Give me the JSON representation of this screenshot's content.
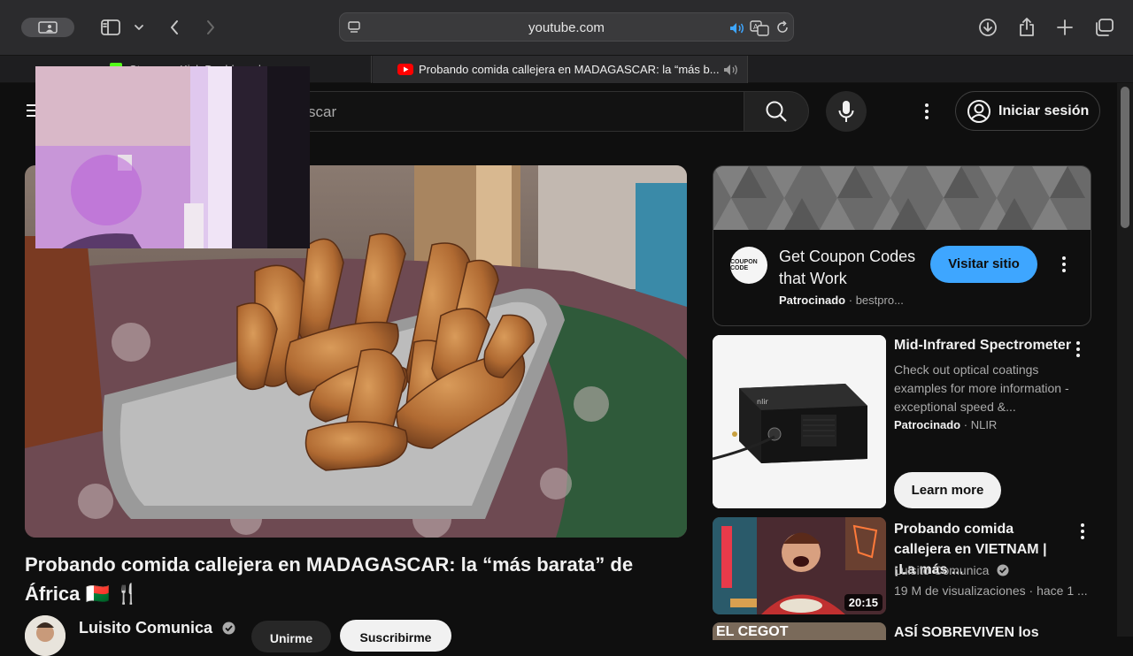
{
  "browser": {
    "address": "youtube.com",
    "tabs": [
      {
        "title": "Streamer Kick Dashboard"
      },
      {
        "title": "Probando comida callejera en MADAGASCAR: la “más b..."
      }
    ]
  },
  "header": {
    "search_placeholder": "scar",
    "signin_label": "Iniciar sesión"
  },
  "video": {
    "title": "Probando comida callejera en MADAGASCAR: la “más barata” de África 🇲🇬 🍴",
    "channel": "Luisito Comunica",
    "join_label": "Unirme",
    "subscribe_label": "Suscribirme"
  },
  "ad": {
    "logo_text": "COUPON CODE",
    "title": "Get Coupon Codes that Work",
    "sponsored": "Patrocinado",
    "domain": "bestpro...",
    "visit_label": "Visitar sitio"
  },
  "promo": {
    "title": "Mid-Infrared Spectrometer",
    "description": "Check out optical coatings examples for more information - exceptional speed &...",
    "sponsored": "Patrocinado",
    "advertiser": "NLIR",
    "learn_label": "Learn more",
    "product_brand": "nlir"
  },
  "recommendations": [
    {
      "title": "Probando comida callejera en VIETNAM | ¡La más ...",
      "channel": "Luisito Comunica",
      "meta": "19 M de visualizaciones · hace 1 ...",
      "duration": "20:15"
    },
    {
      "title": "ASÍ SOBREVIVEN los",
      "thumb_text": "EL CEGOT"
    }
  ],
  "colors": {
    "background": "#0f0f0f",
    "accent_blue": "#3ea6ff",
    "youtube_red": "#ff0000"
  }
}
